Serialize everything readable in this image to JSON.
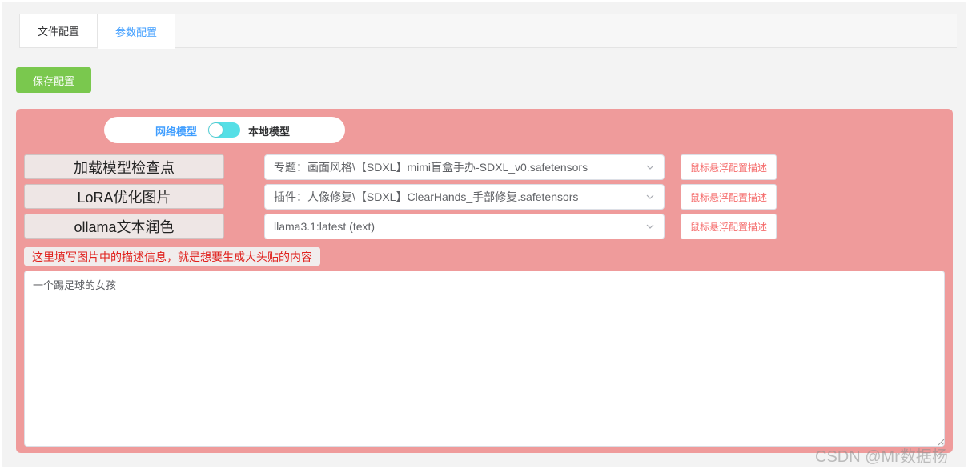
{
  "tabs": [
    {
      "label": "文件配置",
      "active": false
    },
    {
      "label": "参数配置",
      "active": true
    }
  ],
  "toolbar": {
    "save_label": "保存配置"
  },
  "mode_switch": {
    "left_label": "网络模型",
    "right_label": "本地模型",
    "on": true
  },
  "rows": [
    {
      "label": "加载模型检查点",
      "selected": "专题：画面风格\\【SDXL】mimi盲盒手办-SDXL_v0.safetensors",
      "desc_button": "鼠标悬浮配置描述"
    },
    {
      "label": "LoRA优化图片",
      "selected": "插件：人像修复\\【SDXL】ClearHands_手部修复.safetensors",
      "desc_button": "鼠标悬浮配置描述"
    },
    {
      "label": "ollama文本润色",
      "selected": "llama3.1:latest (text)",
      "desc_button": "鼠标悬浮配置描述"
    }
  ],
  "hint": "这里填写图片中的描述信息，就是想要生成大头贴的内容",
  "prompt_text": "一个踢足球的女孩",
  "watermark": "CSDN @Mr数据杨",
  "colors": {
    "accent": "#409eff",
    "save_button": "#7ac84e",
    "panel_bg": "#ef9b9b",
    "toggle_on": "#56dfe6",
    "hint_text": "#e0201c"
  }
}
